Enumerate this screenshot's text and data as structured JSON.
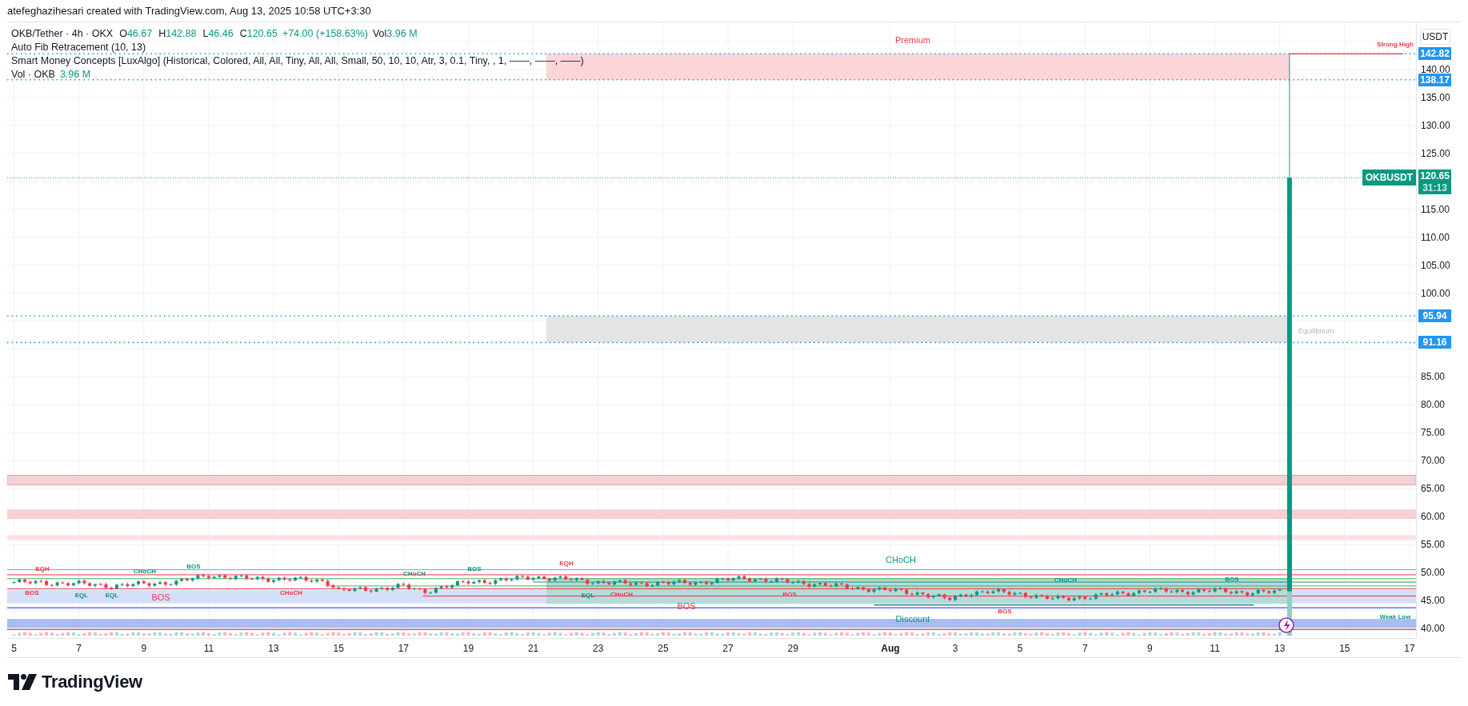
{
  "header": {
    "caption": "atefeghazihesari created with TradingView.com, Aug 13, 2025 10:58 UTC+3:30"
  },
  "legend": {
    "symbol": "OKB/Tether · 4h · OKX",
    "ohlc": [
      {
        "key": "O",
        "value": "46.67"
      },
      {
        "key": "H",
        "value": "142.88"
      },
      {
        "key": "L",
        "value": "46.46"
      },
      {
        "key": "C",
        "value": "120.65"
      }
    ],
    "change": "+74.00 (+158.63%)",
    "volume": {
      "key": "Vol",
      "value": "3.96 M"
    }
  },
  "indicators": [
    {
      "text": "Auto Fib Retracement (10, 13)"
    },
    {
      "text": "Smart Money Concepts [LuxAlgo] (Historical, Colored, All, All, Tiny, All, All, Small, 50, 10, 10, Atr, 3, 0.1, Tiny, , 1, ——, ——, ——)"
    },
    {
      "text": "Vol · OKB",
      "value": "3.96 M"
    }
  ],
  "annotations": [
    {
      "text": "Premium",
      "color": "#f23645"
    },
    {
      "text": "Strong High",
      "color": "#f23645"
    },
    {
      "text": "Equilibrium",
      "color": "#b2b5be"
    },
    {
      "text": "CHoCH",
      "color": "#089981"
    },
    {
      "text": "Discount",
      "color": "#089981"
    },
    {
      "text": "Weak Low",
      "color": "#089981"
    },
    {
      "text": "EQH",
      "color": "#f23645"
    },
    {
      "text": "BOS",
      "color": "#f23645"
    },
    {
      "text": "EQL",
      "color": "#089981"
    },
    {
      "text": "EQL",
      "color": "#089981"
    },
    {
      "text": "BOS",
      "color": "#f23645"
    },
    {
      "text": "CHoCH",
      "color": "#089981"
    },
    {
      "text": "BOS",
      "color": "#089981"
    },
    {
      "text": "CHoCH",
      "color": "#f23645"
    },
    {
      "text": "CHoCH",
      "color": "#089981"
    },
    {
      "text": "BOS",
      "color": "#089981"
    },
    {
      "text": "EQH",
      "color": "#f23645"
    },
    {
      "text": "BOS",
      "color": "#f23645"
    },
    {
      "text": "EQL",
      "color": "#089981"
    },
    {
      "text": "CHoCH",
      "color": "#f23645"
    },
    {
      "text": "BOS",
      "color": "#f23645"
    },
    {
      "text": "CHoCH",
      "color": "#089981"
    },
    {
      "text": "BOS",
      "color": "#089981"
    },
    {
      "text": "BOS",
      "color": "#f23645"
    }
  ],
  "price_axis": {
    "currency_button": "USDT",
    "ticks": [
      "140.00",
      "135.00",
      "130.00",
      "125.00",
      "115.00",
      "110.00",
      "105.00",
      "100.00",
      "85.00",
      "80.00",
      "75.00",
      "70.00",
      "65.00",
      "60.00",
      "55.00",
      "50.00",
      "45.00",
      "40.00"
    ],
    "badges": [
      {
        "text": "142.82"
      },
      {
        "text": "138.17"
      },
      {
        "text": "95.94"
      },
      {
        "text": "91.16"
      }
    ],
    "last_price": {
      "symbol": "OKBUSDT",
      "price": "120.65",
      "countdown": "31:13"
    }
  },
  "time_axis": {
    "ticks": [
      {
        "label": "5",
        "kind": "day"
      },
      {
        "label": "7",
        "kind": "day"
      },
      {
        "label": "9",
        "kind": "day"
      },
      {
        "label": "11",
        "kind": "day"
      },
      {
        "label": "13",
        "kind": "day"
      },
      {
        "label": "15",
        "kind": "day"
      },
      {
        "label": "17",
        "kind": "day"
      },
      {
        "label": "19",
        "kind": "day"
      },
      {
        "label": "21",
        "kind": "day"
      },
      {
        "label": "23",
        "kind": "day"
      },
      {
        "label": "25",
        "kind": "day"
      },
      {
        "label": "27",
        "kind": "day"
      },
      {
        "label": "29",
        "kind": "day"
      },
      {
        "label": "Aug",
        "kind": "month"
      },
      {
        "label": "3",
        "kind": "day"
      },
      {
        "label": "5",
        "kind": "day"
      },
      {
        "label": "7",
        "kind": "day"
      },
      {
        "label": "9",
        "kind": "day"
      },
      {
        "label": "11",
        "kind": "day"
      },
      {
        "label": "13",
        "kind": "day"
      },
      {
        "label": "15",
        "kind": "day"
      },
      {
        "label": "17",
        "kind": "day"
      }
    ]
  },
  "footer": {
    "logo": "TradingView"
  }
}
